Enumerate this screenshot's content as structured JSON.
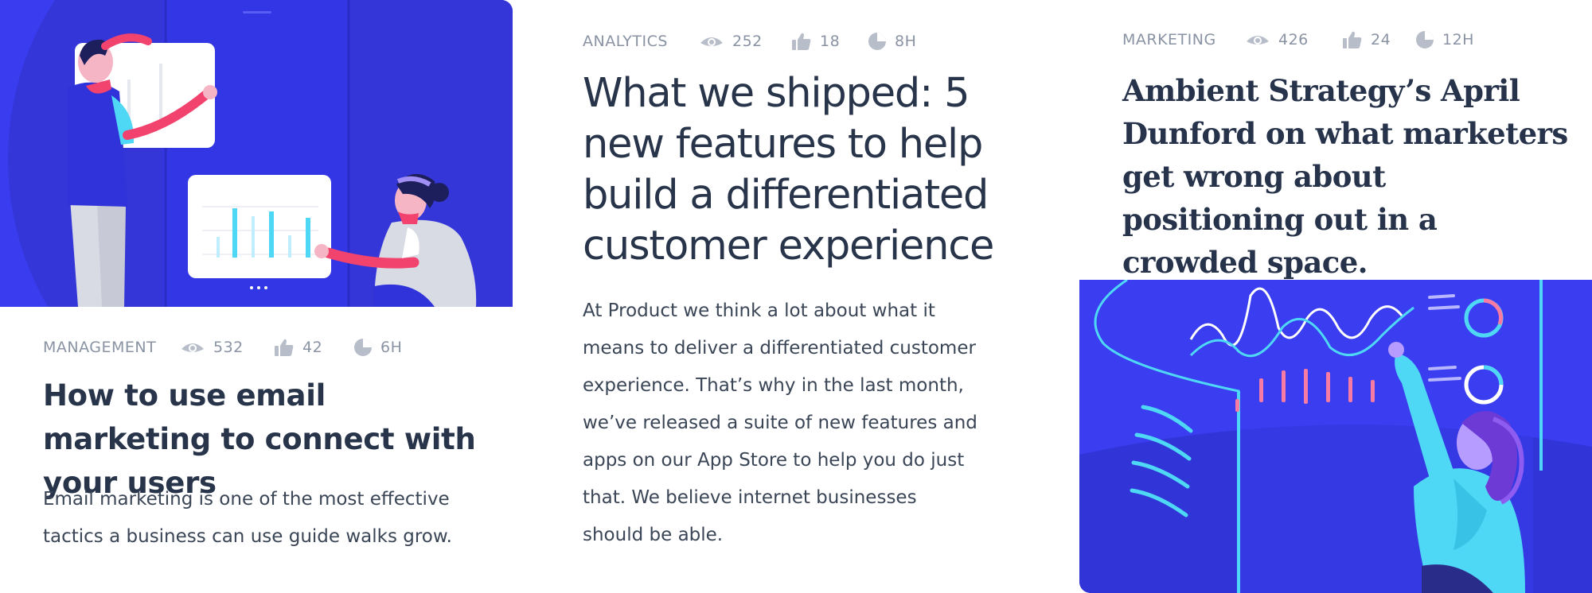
{
  "cards": [
    {
      "category": "MANAGEMENT",
      "views": "532",
      "likes": "42",
      "time": "6H",
      "title": "How to use email marketing to connect with your users",
      "excerpt": "Email marketing is one of the most effective tactics a business can use guide walks grow.",
      "image": "illustration-team-dashboard"
    },
    {
      "category": "ANALYTICS",
      "views": "252",
      "likes": "18",
      "time": "8H",
      "title": "What we shipped: 5 new features to help build a differentiated customer experience",
      "excerpt": "At Product we think a lot about what it means to deliver a differentiated customer experience. That’s why in the last month, we’ve released a suite of new features and apps on our App Store to help you do just that. We believe internet businesses should be able."
    },
    {
      "category": "MARKETING",
      "views": "426",
      "likes": "24",
      "time": "12H",
      "title": "Ambient Strategy’s April Dunford on what marketers get wrong about positioning out in a crowded space.",
      "image": "illustration-analytics-screen"
    }
  ],
  "icons": {
    "views": "eye-icon",
    "likes": "thumbs-up-icon",
    "time": "clock-icon"
  },
  "colors": {
    "illustration_bg": "#3a3df0",
    "meta_text": "#8a93a3",
    "title_text": "#27344a",
    "accent_pink": "#f2436e",
    "accent_cyan": "#4fd8f5"
  }
}
